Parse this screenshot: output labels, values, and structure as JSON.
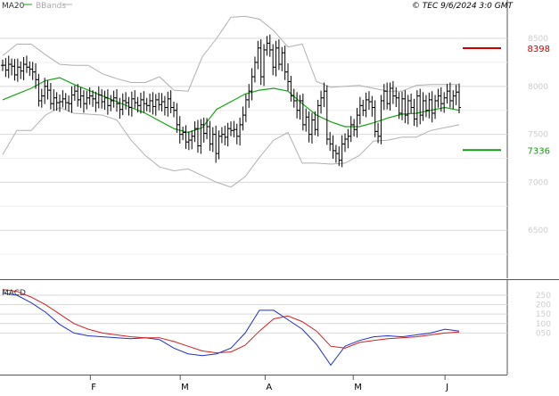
{
  "header": {
    "legend_ma20": "MA20",
    "legend_bbands": "BBands",
    "source_stamp": "© TEC 9/6/2024 3:0 GMT"
  },
  "colors": {
    "ma20": "#17a317",
    "bbands": "#b0b0b0",
    "price": "#000000",
    "resistance": "#cc0000",
    "support": "#1a961a",
    "macd": "#1f2fd0",
    "signal": "#d42020",
    "grid": "#d9d9d9",
    "axis": "#555555"
  },
  "chart_data": [
    {
      "type": "line",
      "title": "",
      "subtitle": "price bars (OHLC) with MA20 and Bollinger Bands",
      "x_tick_labels": [
        "F",
        "M",
        "A",
        "M",
        "J"
      ],
      "y_tick_labels": [
        "8500",
        "8000",
        "7500",
        "7000",
        "6500"
      ],
      "ylim": [
        6000,
        8900
      ],
      "grid": true,
      "levels": [
        {
          "name": "resistance",
          "value": 8398,
          "label": "8398"
        },
        {
          "name": "support",
          "value": 7336,
          "label": "7336"
        }
      ],
      "series": [
        {
          "name": "price",
          "type": "ohlc",
          "values": [
            8220,
            8170,
            8230,
            8210,
            8120,
            8200,
            8160,
            8230,
            8200,
            8180,
            8150,
            8070,
            7850,
            7900,
            8000,
            7960,
            7820,
            7880,
            7830,
            7840,
            7870,
            7830,
            7820,
            7910,
            7950,
            7860,
            7900,
            7820,
            7880,
            7900,
            7870,
            7830,
            7910,
            7840,
            7880,
            7800,
            7850,
            7880,
            7820,
            7760,
            7850,
            7830,
            7780,
            7870,
            7830,
            7800,
            7860,
            7820,
            7800,
            7850,
            7790,
            7860,
            7810,
            7840,
            7780,
            7870,
            7780,
            7750,
            7600,
            7500,
            7520,
            7420,
            7440,
            7480,
            7560,
            7380,
            7600,
            7510,
            7580,
            7400,
            7500,
            7300,
            7480,
            7500,
            7470,
            7560,
            7540,
            7550,
            7480,
            7600,
            7700,
            7860,
            7950,
            8100,
            8250,
            8400,
            8100,
            8380,
            8450,
            8380,
            8200,
            8400,
            8230,
            8350,
            8150,
            8050,
            7900,
            7850,
            7750,
            7850,
            7600,
            7680,
            7500,
            7650,
            7550,
            7800,
            7880,
            7950,
            7450,
            7400,
            7330,
            7300,
            7230,
            7400,
            7450,
            7480,
            7600,
            7550,
            7700,
            7800,
            7750,
            7860,
            7840,
            7780,
            7530,
            7480,
            7850,
            7950,
            7820,
            7980,
            7900,
            7880,
            7720,
            7870,
            7700,
            7850,
            7780,
            7660,
            7900,
            7700,
            7850,
            7750,
            7860,
            7720,
            7850,
            7900,
            7820,
            7880,
            7950,
            7850,
            7900,
            7940,
            7780
          ]
        },
        {
          "name": "MA20",
          "values": [
            7860,
            7920,
            7980,
            8060,
            8090,
            8020,
            7960,
            7900,
            7840,
            7780,
            7720,
            7640,
            7560,
            7520,
            7570,
            7760,
            7840,
            7920,
            7960,
            7980,
            7950,
            7820,
            7700,
            7630,
            7580,
            7580,
            7620,
            7670,
            7710,
            7720,
            7750,
            7780,
            7750
          ]
        },
        {
          "name": "BBands upper",
          "values": [
            8320,
            8440,
            8440,
            8330,
            8230,
            8220,
            8220,
            8130,
            8080,
            8040,
            8040,
            8100,
            7960,
            7950,
            8310,
            8500,
            8720,
            8730,
            8700,
            8580,
            8410,
            8440,
            8050,
            7990,
            8000,
            8010,
            7980,
            7950,
            7950,
            8010,
            8020,
            8020,
            8020
          ]
        },
        {
          "name": "BBands lower",
          "values": [
            7290,
            7540,
            7540,
            7700,
            7780,
            7720,
            7710,
            7700,
            7650,
            7440,
            7280,
            7160,
            7120,
            7140,
            7070,
            7000,
            6950,
            7060,
            7260,
            7440,
            7520,
            7200,
            7200,
            7190,
            7200,
            7280,
            7430,
            7440,
            7470,
            7470,
            7540,
            7570,
            7600
          ]
        }
      ]
    },
    {
      "type": "line",
      "title": "MACD",
      "x_tick_labels": [
        "F",
        "M",
        "A",
        "M",
        "J"
      ],
      "y_tick_labels": [
        "250",
        "200",
        "150",
        "100",
        "050"
      ],
      "ylim": [
        -170,
        330
      ],
      "grid": true,
      "series": [
        {
          "name": "MACD",
          "values": [
            260,
            250,
            210,
            160,
            95,
            50,
            35,
            30,
            25,
            20,
            25,
            15,
            -30,
            -60,
            -70,
            -60,
            -30,
            50,
            170,
            170,
            120,
            70,
            -10,
            -120,
            -20,
            10,
            30,
            35,
            30,
            40,
            50,
            70,
            60
          ]
        },
        {
          "name": "Signal",
          "values": [
            280,
            270,
            240,
            200,
            150,
            100,
            70,
            50,
            40,
            30,
            25,
            25,
            5,
            -20,
            -45,
            -55,
            -50,
            -15,
            60,
            125,
            140,
            110,
            60,
            -20,
            -30,
            0,
            10,
            20,
            25,
            30,
            40,
            50,
            55
          ]
        }
      ]
    }
  ]
}
